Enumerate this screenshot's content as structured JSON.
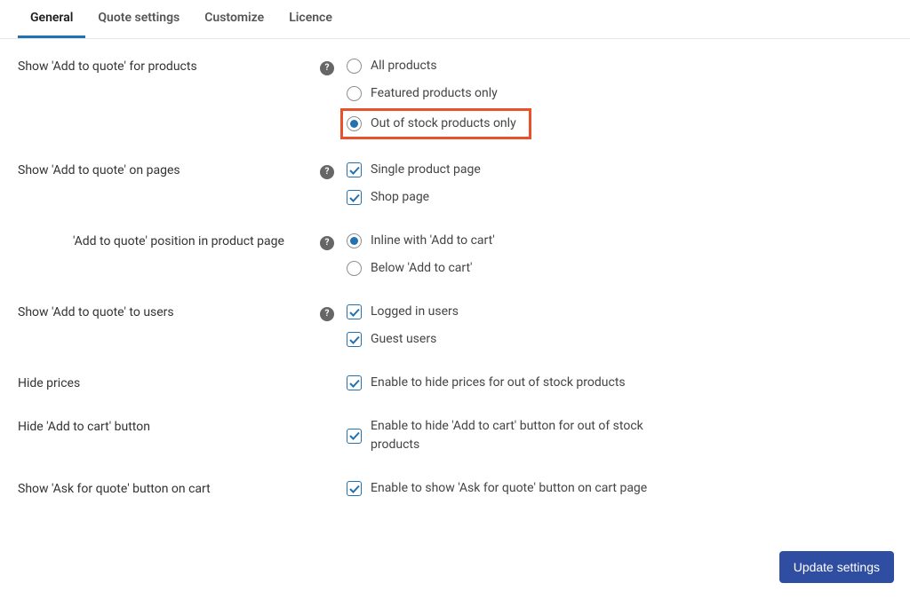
{
  "tabs": {
    "general": "General",
    "quote_settings": "Quote settings",
    "customize": "Customize",
    "licence": "Licence"
  },
  "settings": {
    "show_for_products": {
      "label": "Show 'Add to quote' for products",
      "options": {
        "all": "All products",
        "featured": "Featured products only",
        "out_of_stock": "Out of stock products only"
      },
      "selected": "out_of_stock"
    },
    "show_on_pages": {
      "label": "Show 'Add to quote' on pages",
      "options": {
        "single": "Single product page",
        "shop": "Shop page"
      }
    },
    "position": {
      "label": "'Add to quote' position in product page",
      "options": {
        "inline": "Inline with 'Add to cart'",
        "below": "Below 'Add to cart'"
      },
      "selected": "inline"
    },
    "show_to_users": {
      "label": "Show 'Add to quote' to users",
      "options": {
        "logged_in": "Logged in users",
        "guest": "Guest users"
      }
    },
    "hide_prices": {
      "label": "Hide prices",
      "option": "Enable to hide prices for out of stock products"
    },
    "hide_add_to_cart": {
      "label": "Hide 'Add to cart' button",
      "option": "Enable to hide 'Add to cart' button for out of stock products"
    },
    "show_ask_for_quote": {
      "label": "Show 'Ask for quote' button on cart",
      "option": "Enable to show 'Ask for quote' button on cart page"
    }
  },
  "buttons": {
    "update": "Update settings"
  }
}
